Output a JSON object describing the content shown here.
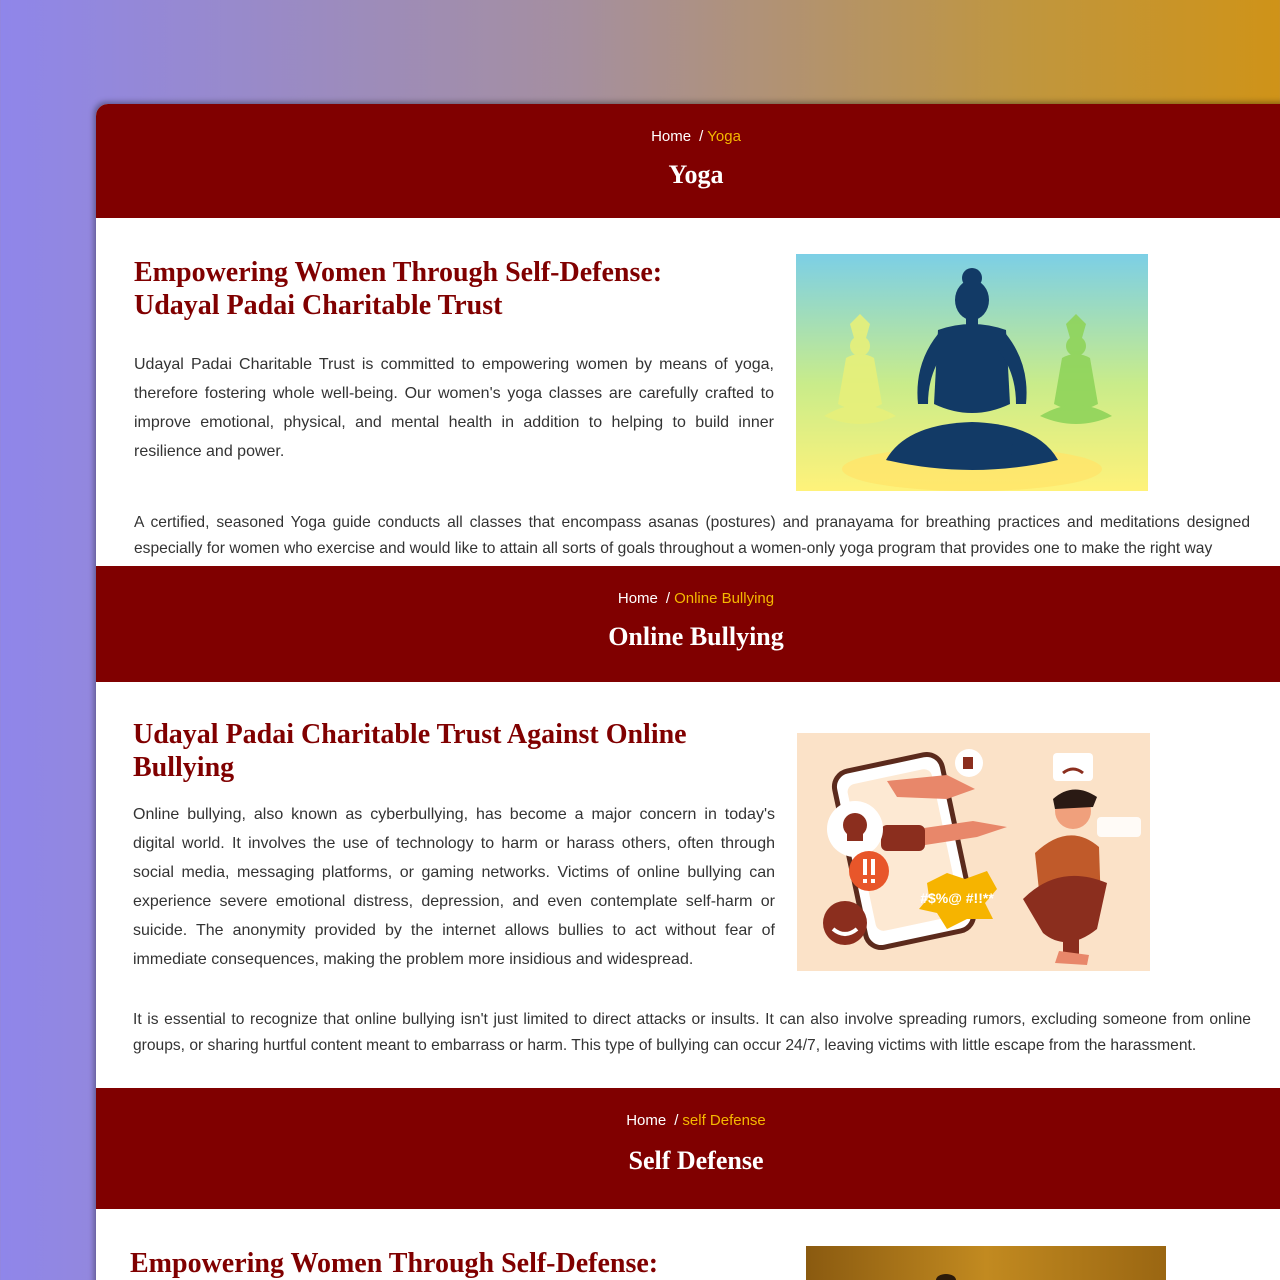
{
  "sections": [
    {
      "breadcrumb": {
        "home": "Home",
        "separator": "/",
        "current": "Yoga"
      },
      "title": "Yoga",
      "heading_line1": "Empowering Women Through Self-Defense:",
      "heading_line2": "Udayal Padai Charitable Trust",
      "paragraph1": "Udayal Padai Charitable Trust is committed to empowering women by means of yoga, therefore fostering whole well-being. Our women's yoga classes are carefully crafted to improve emotional, physical, and mental health in addition to helping to build inner resilience and power.",
      "paragraph2": "A certified, seasoned Yoga guide conducts all classes that encompass asanas (postures) and pranayama for breathing practices and meditations designed especially for women who exercise and would like to attain all sorts of goals throughout a women-only yoga program that provides one to make the right way",
      "image_icon": "yoga-meditation-illustration"
    },
    {
      "breadcrumb": {
        "home": "Home",
        "separator": "/",
        "current": "Online Bullying"
      },
      "title": "Online Bullying",
      "heading_line1": "Udayal Padai Charitable Trust Against Online",
      "heading_line2": "Bullying",
      "paragraph1": "Online bullying, also known as cyberbullying, has become a major concern in today's digital world. It involves the use of technology to harm or harass others, often through social media, messaging platforms, or gaming networks. Victims of online bullying can experience severe emotional distress, depression, and even contemplate self-harm or suicide. The anonymity provided by the internet allows bullies to act without fear of immediate consequences, making the problem more insidious and widespread.",
      "paragraph2": "It is essential to recognize that online bullying isn't just limited to direct attacks or insults. It can also involve spreading rumors, excluding someone from online groups, or sharing hurtful content meant to embarrass or harm. This type of bullying can occur 24/7, leaving victims with little escape from the harassment.",
      "image_icon": "cyberbullying-illustration",
      "image_text": "#$%@ #!!**"
    },
    {
      "breadcrumb": {
        "home": "Home",
        "separator": "/",
        "current": "self Defense"
      },
      "title": "Self Defense",
      "heading_line1": "Empowering Women Through Self-Defense:",
      "image_icon": "self-defense-photo"
    }
  ],
  "colors": {
    "banner": "#800000",
    "heading": "#800000",
    "breadcrumb_current": "#f5b800",
    "body_text": "#333333"
  }
}
